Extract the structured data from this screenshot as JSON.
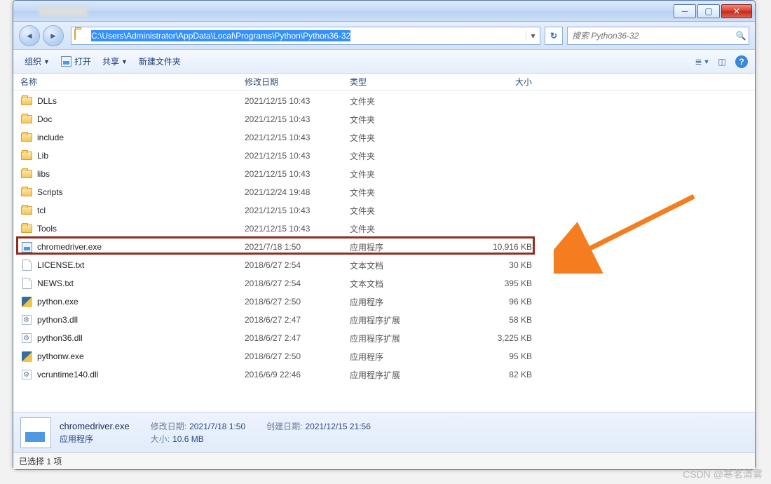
{
  "titlebar": {},
  "nav": {
    "path": "C:\\Users\\Administrator\\AppData\\Local\\Programs\\Python\\Python36-32",
    "search_placeholder": "搜索 Python36-32"
  },
  "toolbar": {
    "organize": "组织",
    "open": "打开",
    "share": "共享",
    "newfolder": "新建文件夹"
  },
  "columns": {
    "name": "名称",
    "date": "修改日期",
    "type": "类型",
    "size": "大小"
  },
  "files": [
    {
      "icon": "folder",
      "name": "DLLs",
      "date": "2021/12/15 10:43",
      "type": "文件夹",
      "size": ""
    },
    {
      "icon": "folder",
      "name": "Doc",
      "date": "2021/12/15 10:43",
      "type": "文件夹",
      "size": ""
    },
    {
      "icon": "folder",
      "name": "include",
      "date": "2021/12/15 10:43",
      "type": "文件夹",
      "size": ""
    },
    {
      "icon": "folder",
      "name": "Lib",
      "date": "2021/12/15 10:43",
      "type": "文件夹",
      "size": ""
    },
    {
      "icon": "folder",
      "name": "libs",
      "date": "2021/12/15 10:43",
      "type": "文件夹",
      "size": ""
    },
    {
      "icon": "folder",
      "name": "Scripts",
      "date": "2021/12/24 19:48",
      "type": "文件夹",
      "size": ""
    },
    {
      "icon": "folder",
      "name": "tcl",
      "date": "2021/12/15 10:43",
      "type": "文件夹",
      "size": ""
    },
    {
      "icon": "folder",
      "name": "Tools",
      "date": "2021/12/15 10:43",
      "type": "文件夹",
      "size": ""
    },
    {
      "icon": "exe",
      "name": "chromedriver.exe",
      "date": "2021/7/18 1:50",
      "type": "应用程序",
      "size": "10,916 KB",
      "highlight": true
    },
    {
      "icon": "txt",
      "name": "LICENSE.txt",
      "date": "2018/6/27 2:54",
      "type": "文本文档",
      "size": "30 KB"
    },
    {
      "icon": "txt",
      "name": "NEWS.txt",
      "date": "2018/6/27 2:54",
      "type": "文本文档",
      "size": "395 KB"
    },
    {
      "icon": "py",
      "name": "python.exe",
      "date": "2018/6/27 2:50",
      "type": "应用程序",
      "size": "96 KB"
    },
    {
      "icon": "dll",
      "name": "python3.dll",
      "date": "2018/6/27 2:47",
      "type": "应用程序扩展",
      "size": "58 KB"
    },
    {
      "icon": "dll",
      "name": "python36.dll",
      "date": "2018/6/27 2:47",
      "type": "应用程序扩展",
      "size": "3,225 KB"
    },
    {
      "icon": "py",
      "name": "pythonw.exe",
      "date": "2018/6/27 2:50",
      "type": "应用程序",
      "size": "95 KB"
    },
    {
      "icon": "dll",
      "name": "vcruntime140.dll",
      "date": "2016/6/9 22:46",
      "type": "应用程序扩展",
      "size": "82 KB"
    }
  ],
  "details": {
    "filename": "chromedriver.exe",
    "filetype": "应用程序",
    "mod_label": "修改日期:",
    "mod_val": "2021/7/18 1:50",
    "size_label": "大小:",
    "size_val": "10.6 MB",
    "create_label": "创建日期:",
    "create_val": "2021/12/15 21:56"
  },
  "status": {
    "text": "已选择 1 项"
  },
  "watermark": "CSDN @寒茗清雾"
}
